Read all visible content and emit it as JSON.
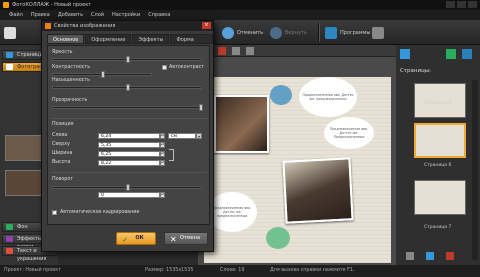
{
  "app": {
    "title": "ФотоКОЛЛАЖ - Новый проект"
  },
  "menu": [
    "Файл",
    "Правка",
    "Добавить",
    "Слой",
    "Настройки",
    "Справка"
  ],
  "toolbar": {
    "undo_label": "Отменить",
    "redo_label": "Вернуть",
    "programs_label": "Программы"
  },
  "left_panel": {
    "tabs": [
      "Страницы",
      "Фотографии",
      "Фон",
      "Эффекты и рамки",
      "Текст и украшения"
    ]
  },
  "dialog": {
    "title": "Свойства изображения",
    "tabs": [
      "Основное",
      "Оформление",
      "Эффекты",
      "Форма слоя"
    ],
    "active_tab": "Основное",
    "brightness_label": "Яркость",
    "contrast_label": "Контрастность",
    "autocontrast_label": "Автоконтраст",
    "saturation_label": "Насыщенность",
    "transparency_label": "Прозрачность",
    "position_label": "Позиция",
    "left_label": "Слева",
    "left_value": "6,24",
    "top_label": "Сверху",
    "top_value": "5,35",
    "width_label": "Ширина",
    "width_value": "6,25",
    "height_label": "Высота",
    "height_value": "8,22",
    "unit_value": "см",
    "rotation_label": "Поворот",
    "rotation_value": "0",
    "autocrop_label": "Автоматическое кадрирование",
    "ok_label": "ОК",
    "cancel_label": "Отмена"
  },
  "canvas": {
    "bubble_texts": [
      "Предназначенная ява, Доттес же, предназначенных",
      "Предназначенная ява. Доттес же. Предназначенные",
      "Предназначенная ява, Доттес же предназначенных"
    ]
  },
  "right_panel": {
    "title": "Страницы:",
    "pages": [
      "Страница 5",
      "Страница 6",
      "Страница 7"
    ]
  },
  "status": {
    "project": "Проект: Новый проект",
    "size": "Размер: 1535х1535",
    "layers": "Слоев: 19",
    "help": "Для вызова справки нажмите F1."
  },
  "colors": {
    "accent": "#f0a830",
    "bg": "#2b2b2b"
  }
}
